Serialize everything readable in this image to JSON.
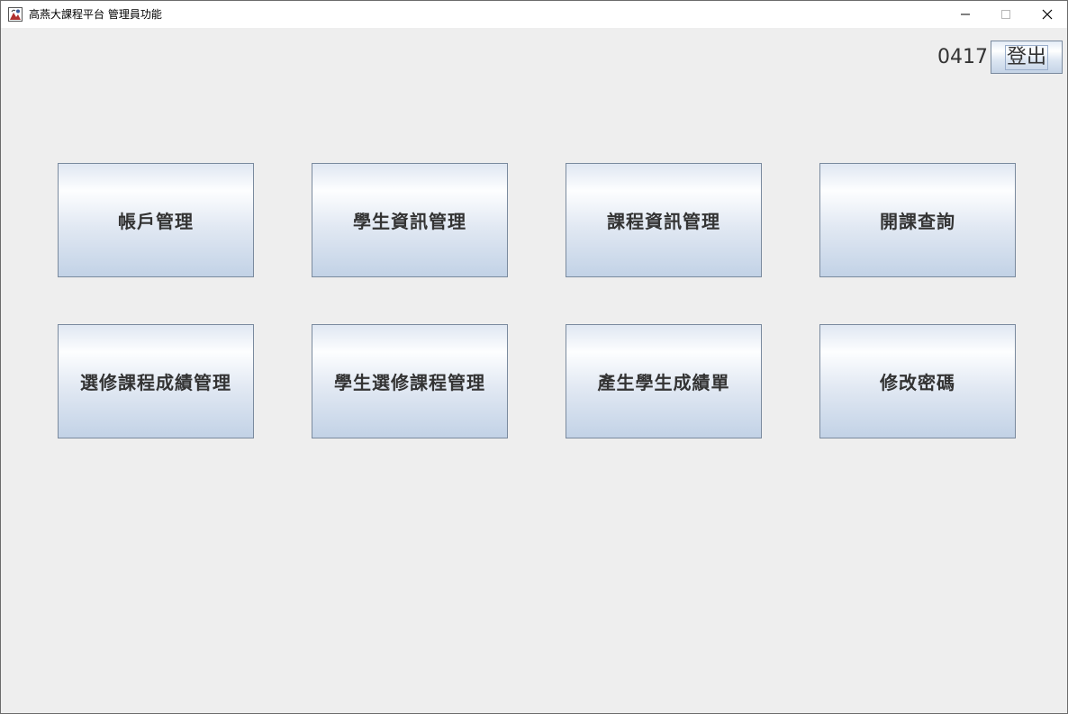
{
  "window": {
    "title": "高燕大課程平台 管理員功能",
    "icon": "java-app-icon",
    "controls": {
      "minimize": "minimize-icon",
      "maximize": "maximize-icon",
      "close": "close-icon"
    }
  },
  "header": {
    "user_id": "0417",
    "logout_label": "登出"
  },
  "functions": [
    {
      "label": "帳戶管理"
    },
    {
      "label": "學生資訊管理"
    },
    {
      "label": "課程資訊管理"
    },
    {
      "label": "開課查詢"
    },
    {
      "label": "選修課程成績管理"
    },
    {
      "label": "學生選修課程管理"
    },
    {
      "label": "產生學生成績單"
    },
    {
      "label": "修改密碼"
    }
  ],
  "colors": {
    "background": "#eeeeee",
    "button_border": "#7a8a9e",
    "button_gradient_top": "#fdfeff",
    "button_gradient_bottom": "#c2d2e6",
    "text": "#333333"
  }
}
